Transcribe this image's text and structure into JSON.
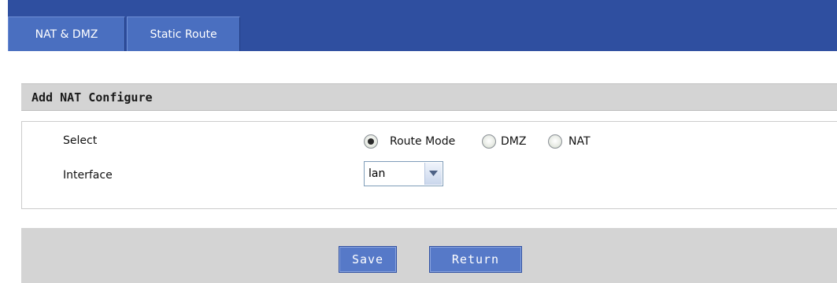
{
  "tabs": [
    {
      "label": "NAT & DMZ",
      "active": true
    },
    {
      "label": "Static Route",
      "active": false
    }
  ],
  "section": {
    "title": "Add NAT Configure"
  },
  "form": {
    "select_label": "Select",
    "mode_options": [
      {
        "label": "Route Mode",
        "checked": true
      },
      {
        "label": "DMZ",
        "checked": false
      },
      {
        "label": "NAT",
        "checked": false
      }
    ],
    "interface_label": "Interface",
    "interface_value": "lan"
  },
  "actions": {
    "save_label": "Save",
    "return_label": "Return"
  },
  "colors": {
    "header_blue": "#2f4fa0",
    "tab_blue": "#4a6fc0",
    "button_blue": "#5679c8",
    "panel_gray": "#d4d4d4"
  },
  "icons": {
    "dropdown": "chevron-down-icon"
  }
}
